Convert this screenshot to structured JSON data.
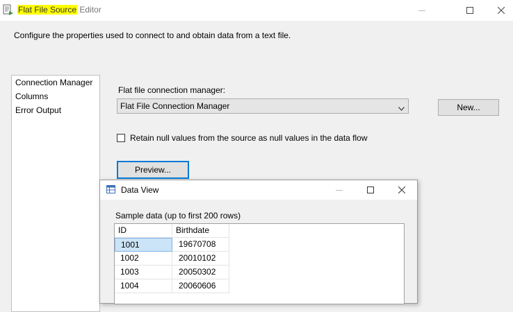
{
  "window": {
    "title_highlighted": "Flat File Source",
    "title_rest": " Editor"
  },
  "description": "Configure the properties used to connect to and obtain data from a text file.",
  "nav": {
    "items": [
      {
        "label": "Connection Manager"
      },
      {
        "label": "Columns"
      },
      {
        "label": "Error Output"
      }
    ]
  },
  "connection": {
    "label": "Flat file connection manager:",
    "selected": "Flat File Connection Manager",
    "new_button": "New..."
  },
  "retain_nulls": {
    "label": "Retain null values from the source as null values in the data flow",
    "checked": false
  },
  "preview_button": "Preview...",
  "data_view": {
    "title": "Data View",
    "caption": "Sample data (up to first 200 rows)",
    "columns": [
      "ID",
      "Birthdate"
    ],
    "rows": [
      [
        "1001",
        "19670708"
      ],
      [
        "1002",
        "20010102"
      ],
      [
        "1003",
        "20050302"
      ],
      [
        "1004",
        "20060606"
      ]
    ]
  },
  "colors": {
    "highlight": "#ffff00",
    "focus_border": "#0078d7",
    "selected_cell": "#cce4f7"
  }
}
